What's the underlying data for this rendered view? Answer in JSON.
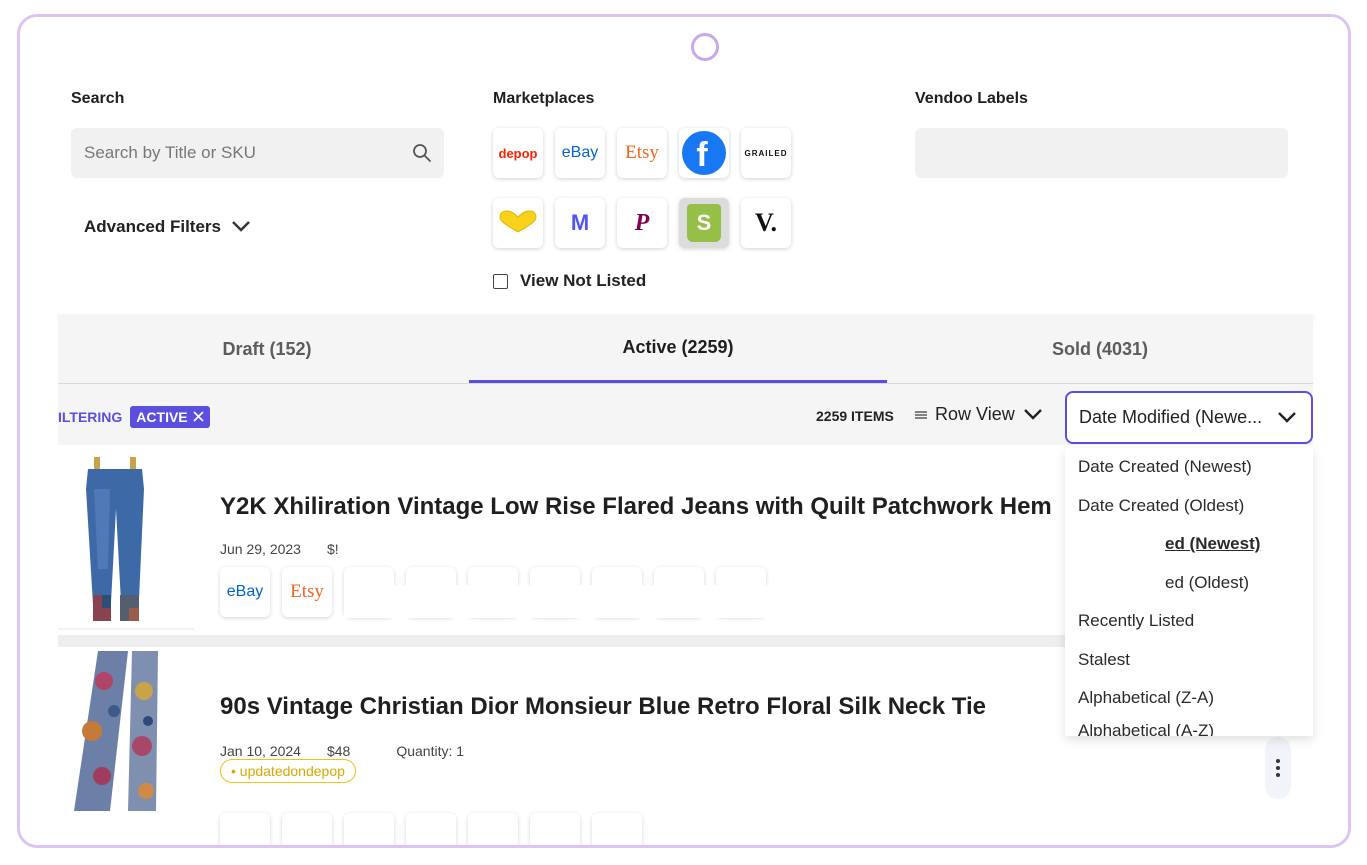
{
  "filters": {
    "search_label": "Search",
    "search_placeholder": "Search by Title or SKU",
    "advanced_label": "Advanced Filters",
    "marketplaces_label": "Marketplaces",
    "vendoo_labels_label": "Vendoo Labels",
    "view_not_listed_label": "View Not Listed",
    "marketplaces": [
      {
        "name": "depop",
        "text": "depop",
        "color": "#ff2300"
      },
      {
        "name": "ebay",
        "text": "eBay",
        "color": "#0064d2"
      },
      {
        "name": "etsy",
        "text": "Etsy",
        "color": "#f1641e"
      },
      {
        "name": "facebook",
        "text": "f",
        "color": "#1877f2"
      },
      {
        "name": "grailed",
        "text": "GRAILED",
        "color": "#111111"
      },
      {
        "name": "kidizen",
        "text": "",
        "color": "#f8d21b"
      },
      {
        "name": "mercari",
        "text": "M",
        "color": "#5356ee"
      },
      {
        "name": "poshmark",
        "text": "P",
        "color": "#7f0353"
      },
      {
        "name": "shopify",
        "text": "S",
        "color": "#95bf47"
      },
      {
        "name": "vestiaire",
        "text": "V.",
        "color": "#111111"
      }
    ]
  },
  "tabs": [
    {
      "label": "Draft (152)"
    },
    {
      "label": "Active (2259)"
    },
    {
      "label": "Sold (4031)"
    }
  ],
  "toolbar": {
    "filtering_label": "ILTERING",
    "chip_label": "ACTIVE",
    "count_label": "2259 ITEMS",
    "view_label": "Row View",
    "sort_value": "Date Modified (Newe..."
  },
  "sort_options": [
    "Date Created (Newest)",
    "Date Created (Oldest)",
    "ed (Newest)",
    "ed (Oldest)",
    "Recently Listed",
    "Stalest",
    "Alphabetical (Z-A)",
    "Alphabetical (A-Z)"
  ],
  "listings": [
    {
      "title": "Y2K Xhiliration Vintage Low Rise Flared Jeans with Quilt Patchwork Hem",
      "date": "Jun 29, 2023",
      "price": "$!",
      "quantity": "",
      "badge": "",
      "marketplaces": [
        "eBay",
        "Etsy"
      ]
    },
    {
      "title": "90s Vintage Christian Dior Monsieur Blue Retro Floral Silk Neck Tie",
      "date": "Jan 10, 2024",
      "price": "$48",
      "quantity": "Quantity: 1",
      "badge": "• updatedondepop",
      "marketplaces": []
    }
  ],
  "colors": {
    "accent": "#5b4fe0",
    "frame": "#dcc4f3",
    "badge": "#f0c419"
  }
}
